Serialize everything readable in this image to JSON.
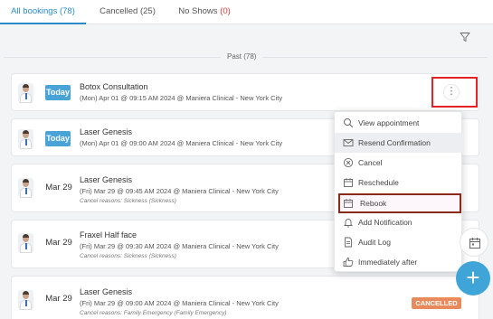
{
  "tabs": [
    {
      "label": "All bookings (78)",
      "active": true
    },
    {
      "label": "Cancelled (25)",
      "active": false
    },
    {
      "label": "No Shows",
      "count": "(0)",
      "active": false
    }
  ],
  "section_label": "Past (78)",
  "bookings": [
    {
      "date": "Today",
      "title": "Botox Consultation",
      "details": "(Mon) Apr 01 @ 09:15 AM 2024 @ Maniera Clinical - New York City",
      "reason": ""
    },
    {
      "date": "Today",
      "title": "Laser Genesis",
      "details": "(Mon) Apr 01 @ 09:00 AM 2024 @ Maniera Clinical - New York City",
      "reason": ""
    },
    {
      "date": "Mar 29",
      "title": "Laser Genesis",
      "details": "(Fri) Mar 29 @ 09:45 AM 2024 @ Maniera Clinical - New York City",
      "reason": "Cancel reasons: Sickness (Sickness)"
    },
    {
      "date": "Mar 29",
      "title": "Fraxel Half face",
      "details": "(Fri) Mar 29 @ 09:30 AM 2024 @ Maniera Clinical - New York City",
      "reason": "Cancel reasons: Sickness (Sickness)"
    },
    {
      "date": "Mar 29",
      "title": "Laser Genesis",
      "details": "(Fri) Mar 29 @ 09:00 AM 2024 @ Maniera Clinical - New York City",
      "reason": "Cancel reasons: Family Emergency (Family Emergency)",
      "status": "CANCELLED"
    }
  ],
  "menu": {
    "items": [
      {
        "label": "View appointment",
        "icon": "search-icon"
      },
      {
        "label": "Resend Confirmation",
        "icon": "envelope-icon"
      },
      {
        "label": "Cancel",
        "icon": "cancel-circle-icon"
      },
      {
        "label": "Reschedule",
        "icon": "calendar-icon"
      },
      {
        "label": "Rebook",
        "icon": "calendar-icon"
      },
      {
        "label": "Add Notification",
        "icon": "bell-icon"
      },
      {
        "label": "Audit Log",
        "icon": "document-icon"
      },
      {
        "label": "Immediately after",
        "icon": "thumbs-up-icon"
      }
    ]
  },
  "kebab_label": "⋮",
  "fab_label": "+",
  "colors": {
    "accent": "#2a89c7",
    "today_badge": "#4aa3d6",
    "highlight_box": "#e52227",
    "rebook_box": "#8a2b1a",
    "cancelled_badge": "#e98a5c",
    "fab": "#3fa4d8"
  }
}
